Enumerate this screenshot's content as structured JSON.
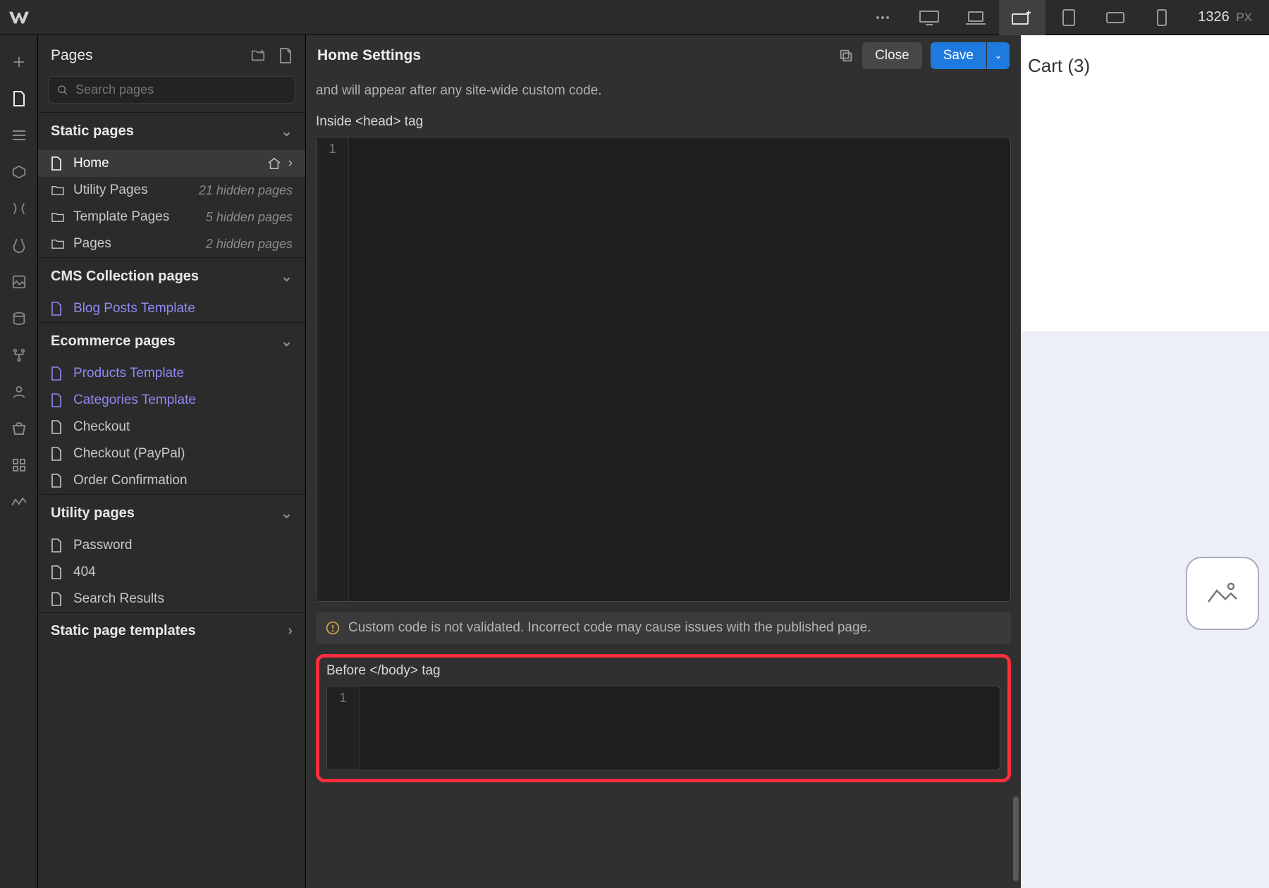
{
  "topbar": {
    "width_value": "1326",
    "width_unit": "PX"
  },
  "pagesPanel": {
    "title": "Pages",
    "searchPlaceholder": "Search pages",
    "sections": {
      "static": {
        "title": "Static pages",
        "items": [
          {
            "label": "Home",
            "selected": true
          },
          {
            "label": "Utility Pages",
            "meta": "21 hidden pages"
          },
          {
            "label": "Template Pages",
            "meta": "5 hidden pages"
          },
          {
            "label": "Pages",
            "meta": "2 hidden pages"
          }
        ]
      },
      "cms": {
        "title": "CMS Collection pages",
        "items": [
          {
            "label": "Blog Posts Template",
            "tpl": true
          }
        ]
      },
      "ecom": {
        "title": "Ecommerce pages",
        "items": [
          {
            "label": "Products Template",
            "tpl": true
          },
          {
            "label": "Categories Template",
            "tpl": true
          },
          {
            "label": "Checkout"
          },
          {
            "label": "Checkout (PayPal)"
          },
          {
            "label": "Order Confirmation"
          }
        ]
      },
      "utility": {
        "title": "Utility pages",
        "items": [
          {
            "label": "Password"
          },
          {
            "label": "404"
          },
          {
            "label": "Search Results"
          }
        ]
      },
      "templates": {
        "title": "Static page templates"
      }
    }
  },
  "settings": {
    "title": "Home Settings",
    "closeLabel": "Close",
    "saveLabel": "Save",
    "descTail": "and will appear after any site-wide custom code.",
    "headLabel": "Inside <head> tag",
    "gutter1": "1",
    "warningText": "Custom code is not validated. Incorrect code may cause issues with the published page.",
    "bodyLabel": "Before </body> tag",
    "gutter2": "1"
  },
  "preview": {
    "cartLabel": "Cart (3)"
  }
}
